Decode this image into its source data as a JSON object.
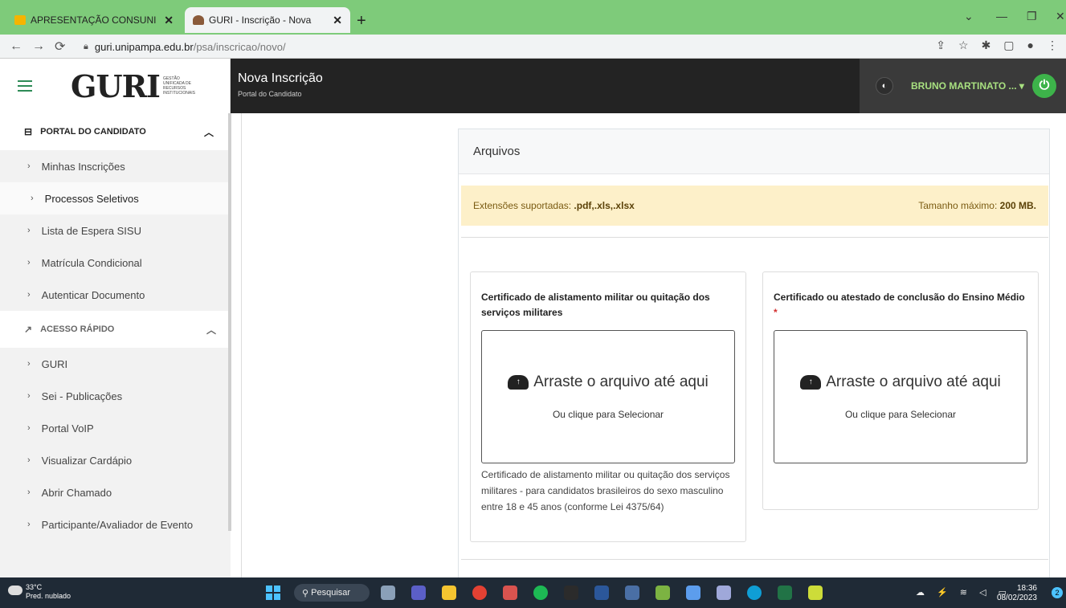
{
  "browser": {
    "tabs": [
      {
        "title": "APRESENTAÇÃO CONSUNI - CAL"
      },
      {
        "title": "GURI - Inscrição - Nova"
      }
    ],
    "url_host": "guri.unipampa.edu.br",
    "url_path": "/psa/inscricao/novo/"
  },
  "header": {
    "logo_text": "GURI",
    "logo_sub": "GESTÃO UNIFICADA DE RECURSOS INSTITUCIONAIS",
    "title": "Nova Inscrição",
    "subtitle": "Portal do Candidato",
    "user": "BRUNO MARTINATO ... ▾"
  },
  "sidebar": {
    "section1": "PORTAL DO CANDIDATO",
    "items1": [
      "Minhas Inscrições",
      "Processos Seletivos",
      "Lista de Espera SISU",
      "Matrícula Condicional",
      "Autenticar Documento"
    ],
    "section2": "ACESSO RÁPIDO",
    "items2": [
      "GURI",
      "Sei - Publicações",
      "Portal VoIP",
      "Visualizar Cardápio",
      "Abrir Chamado",
      "Participante/Avaliador de Evento"
    ]
  },
  "main": {
    "card_title": "Arquivos",
    "alert_left_label": "Extensões suportadas:",
    "alert_left_value": ".pdf,.xls,.xlsx",
    "alert_right_label": "Tamanho máximo:",
    "alert_right_value": "200 MB.",
    "uploads": [
      {
        "title": "Certificado de alistamento militar ou quitação dos serviços militares",
        "required_mark": "",
        "drop_text": "Arraste o arquivo até aqui",
        "drop_sub": "Ou clique para Selecionar",
        "help": "Certificado de alistamento militar ou quitação dos serviços militares - para candidatos brasileiros do sexo masculino entre 18 e 45 anos (conforme Lei 4375/64)"
      },
      {
        "title": "Certificado ou atestado de conclusão do Ensino Médio",
        "required_mark": "*",
        "drop_text": "Arraste o arquivo até aqui",
        "drop_sub": "Ou clique para Selecionar",
        "help": ""
      }
    ]
  },
  "taskbar": {
    "temp": "33°C",
    "weather": "Pred. nublado",
    "search": "Pesquisar",
    "time": "18:36",
    "date": "08/02/2023",
    "notif_count": "2"
  }
}
